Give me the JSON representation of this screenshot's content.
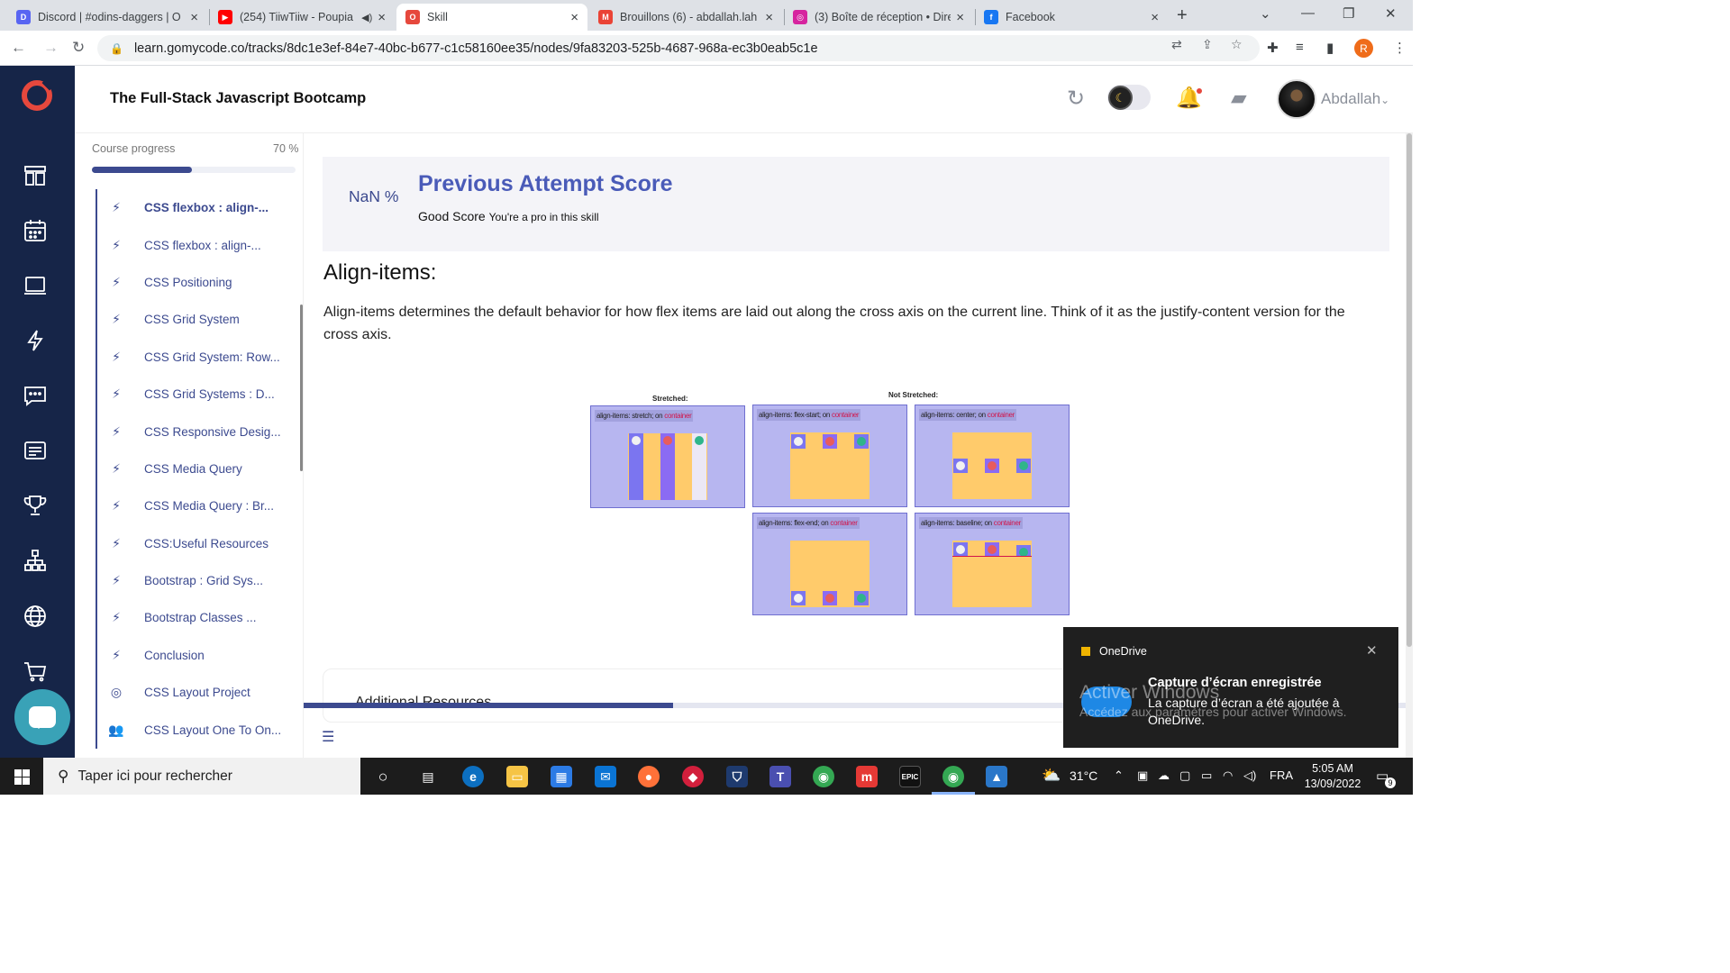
{
  "browser": {
    "tabs": [
      {
        "title": "Discord | #odins-daggers | O",
        "fav_color": "#5865f2",
        "fav_glyph": "D",
        "active": false
      },
      {
        "title": "(254) TiiwTiiw - Poupia",
        "fav_color": "#ff0000",
        "fav_glyph": "▶",
        "active": false,
        "audio": true
      },
      {
        "title": "Skill",
        "fav_color": "#e6483d",
        "fav_glyph": "O",
        "active": true
      },
      {
        "title": "Brouillons (6) - abdallah.lah",
        "fav_color": "#ea4335",
        "fav_glyph": "M",
        "active": false
      },
      {
        "title": "(3) Boîte de réception • Dire",
        "fav_color": "#d6249f",
        "fav_glyph": "◎",
        "active": false
      },
      {
        "title": "Facebook",
        "fav_color": "#1877f2",
        "fav_glyph": "f",
        "active": false
      }
    ],
    "url": "learn.gomycode.co/tracks/8dc1e3ef-84e7-40bc-b677-c1c58160ee35/nodes/9fa83203-525b-4687-968a-ec3b0eab5c1e",
    "profile_initial": "R"
  },
  "header": {
    "course_title": "The Full-Stack Javascript Bootcamp",
    "username": "Abdallah"
  },
  "sidebar": {
    "progress_label": "Course progress",
    "progress_pct_text": "70 %",
    "progress_fraction": 0.7,
    "lessons": [
      {
        "label": "CSS flexbox : align-...",
        "icon": "⚡",
        "current": true
      },
      {
        "label": "CSS flexbox : align-...",
        "icon": "⚡"
      },
      {
        "label": "CSS Positioning",
        "icon": "⚡"
      },
      {
        "label": "CSS Grid System",
        "icon": "⚡"
      },
      {
        "label": "CSS Grid System: Row...",
        "icon": "⚡"
      },
      {
        "label": "CSS Grid Systems : D...",
        "icon": "⚡"
      },
      {
        "label": "CSS Responsive Desig...",
        "icon": "⚡"
      },
      {
        "label": "CSS Media Query",
        "icon": "⚡"
      },
      {
        "label": "CSS Media Query : Br...",
        "icon": "⚡"
      },
      {
        "label": "CSS:Useful Resources",
        "icon": "⚡"
      },
      {
        "label": "Bootstrap : Grid Sys...",
        "icon": "⚡"
      },
      {
        "label": "Bootstrap Classes ...",
        "icon": "⚡"
      },
      {
        "label": "Conclusion",
        "icon": "⚡"
      },
      {
        "label": "CSS Layout Project",
        "icon": "◎"
      },
      {
        "label": "CSS Layout One To On...",
        "icon": "👥"
      }
    ]
  },
  "score": {
    "percent": "NaN %",
    "title": "Previous Attempt Score",
    "good": "Good Score",
    "sub": "You're a pro in this skill"
  },
  "content": {
    "heading": "Align-items:",
    "paragraph": "Align-items determines the default behavior for how flex items are laid out along the cross axis on the current line. Think of it as the justify-content version for the cross axis.",
    "additional_resources": "Additional Resources"
  },
  "diagram": {
    "label_stretched": "Stretched:",
    "label_not_stretched": "Not Stretched:",
    "container_word": "container",
    "on_word": "on",
    "boxes": [
      {
        "prop": "align-items: stretch;",
        "mode": "stretch"
      },
      {
        "prop": "align-items: flex-start;",
        "mode": "flex-start"
      },
      {
        "prop": "align-items: center;",
        "mode": "center"
      },
      {
        "prop": "align-items: flex-end;",
        "mode": "flex-end"
      },
      {
        "prop": "align-items: baseline;",
        "mode": "baseline"
      }
    ]
  },
  "toast": {
    "app": "OneDrive",
    "title": "Capture d’écran enregistrée",
    "body": "La capture d’écran a été ajoutée à OneDrive."
  },
  "watermark": {
    "line1": "Activer Windows",
    "line2": "Accédez aux paramètres pour activer Windows."
  },
  "taskbar": {
    "search_placeholder": "Taper ici pour rechercher",
    "temperature": "31°C",
    "language": "FRA",
    "time": "5:05 AM",
    "date": "13/09/2022",
    "notif_count": "9"
  }
}
